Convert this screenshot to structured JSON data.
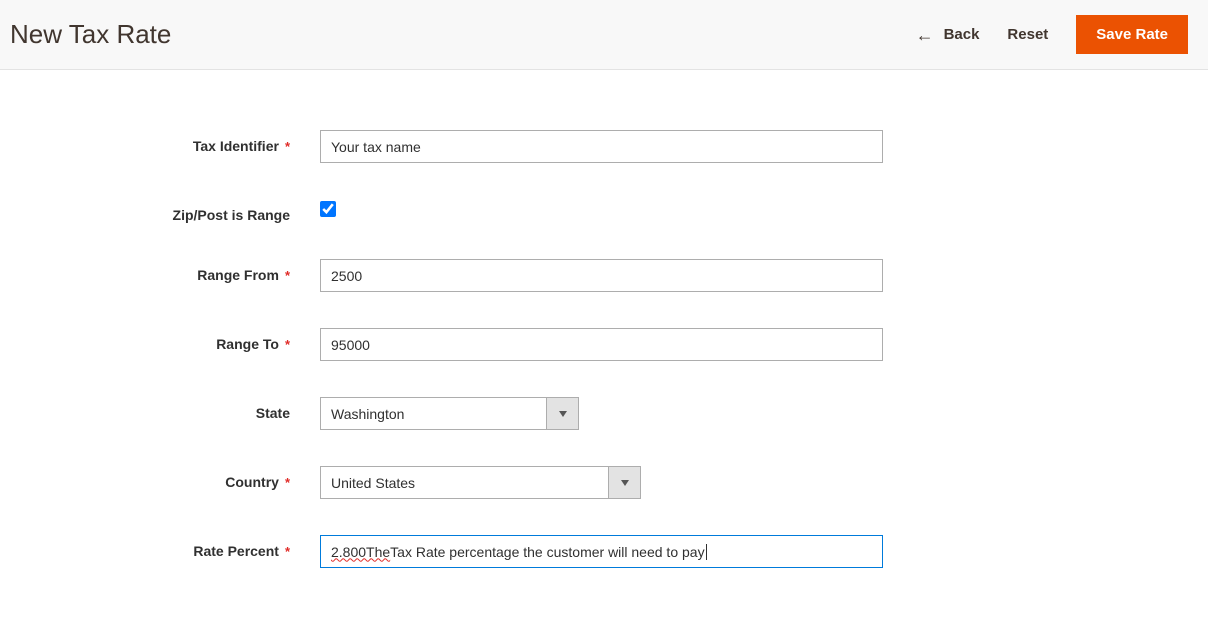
{
  "header": {
    "title": "New Tax Rate",
    "back_label": "Back",
    "reset_label": "Reset",
    "save_label": "Save Rate"
  },
  "form": {
    "tax_identifier": {
      "label": "Tax Identifier",
      "value": "Your tax name",
      "required": true
    },
    "zip_range": {
      "label": "Zip/Post is Range",
      "checked": true
    },
    "range_from": {
      "label": "Range From",
      "value": "2500",
      "required": true
    },
    "range_to": {
      "label": "Range To",
      "value": "95000",
      "required": true
    },
    "state": {
      "label": "State",
      "value": "Washington",
      "required": false
    },
    "country": {
      "label": "Country",
      "value": "United States",
      "required": true
    },
    "rate_percent": {
      "label": "Rate Percent",
      "value_prefix": "2.800The",
      "value_rest": " Tax Rate percentage the customer will need to pay",
      "required": true
    }
  }
}
